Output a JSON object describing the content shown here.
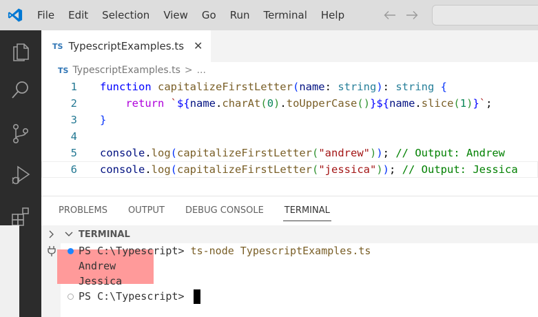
{
  "menu": [
    "File",
    "Edit",
    "Selection",
    "View",
    "Go",
    "Run",
    "Terminal",
    "Help"
  ],
  "icons": {
    "logo": "vscode-logo",
    "explorer": "files-icon",
    "search": "search-icon",
    "source_control": "source-control-icon",
    "run_debug": "run-debug-icon",
    "extensions": "extensions-icon"
  },
  "colors": {
    "accent": "#1a85ff",
    "highlight": "#ff9a9a",
    "activitybar": "#2c2c2c"
  },
  "tab": {
    "badge": "TS",
    "label": "TypescriptExamples.ts",
    "close": "✕"
  },
  "breadcrumb": {
    "badge": "TS",
    "file": "TypescriptExamples.ts",
    "sep": ">",
    "more": "..."
  },
  "code": {
    "line_numbers": [
      "1",
      "2",
      "3",
      "4",
      "5",
      "6"
    ],
    "l1": {
      "kw": "function",
      "fn": "capitalizeFirstLetter",
      "p1": "(",
      "param": "name",
      "colon": ": ",
      "t1": "string",
      "p2": ")",
      "colon2": ": ",
      "t2": "string",
      "brace": " {"
    },
    "l2": {
      "kw": "return",
      "tmpl_open": "`",
      "d1": "${",
      "o1": "name",
      "m1": ".",
      "f1": "charAt",
      "a1": "(",
      "n1": "0",
      "a2": ")",
      "m2": ".",
      "f2": "toUpperCase",
      "a3": "()",
      "d1c": "}",
      "d2": "${",
      "o2": "name",
      "m3": ".",
      "f3": "slice",
      "a4": "(",
      "n2": "1",
      "a5": ")",
      "d2c": "}",
      "tmpl_close": "`",
      "semi": ";"
    },
    "l3": {
      "brace": "}"
    },
    "l5": {
      "obj": "console",
      "dot": ".",
      "fn": "log",
      "p1": "(",
      "fn2": "capitalizeFirstLetter",
      "p2": "(",
      "str": "\"andrew\"",
      "p3": ")",
      "p4": ")",
      "semi": "; ",
      "cmt": "// Output: Andrew"
    },
    "l6": {
      "obj": "console",
      "dot": ".",
      "fn": "log",
      "p1": "(",
      "fn2": "capitalizeFirstLetter",
      "p2": "(",
      "str": "\"jessica\"",
      "p3": ")",
      "p4": ")",
      "semi": "; ",
      "cmt": "// Output: Jessica"
    }
  },
  "panel": {
    "tabs": [
      "PROBLEMS",
      "OUTPUT",
      "DEBUG CONSOLE",
      "TERMINAL"
    ],
    "active_tab": "TERMINAL",
    "section_label": "TERMINAL"
  },
  "terminal": {
    "prompt1": "PS C:\\Typescript> ",
    "command": "ts-node TypescriptExamples.ts",
    "out1": "Andrew",
    "out2": "Jessica",
    "prompt2": "PS C:\\Typescript> "
  }
}
